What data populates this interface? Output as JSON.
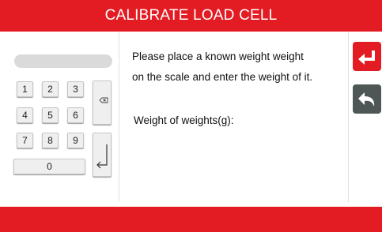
{
  "header": {
    "title": "CALIBRATE LOAD CELL"
  },
  "keypad": {
    "display_value": "",
    "keys": [
      "1",
      "2",
      "3",
      "4",
      "5",
      "6",
      "7",
      "8",
      "9",
      "0"
    ],
    "backspace_icon": "backspace-icon",
    "enter_icon": "enter-arrow-icon"
  },
  "instructions": {
    "line1": "Please place a known weight weight",
    "line2": "on the scale and enter the weight of it.",
    "weight_label": "Weight of weights(g):"
  },
  "side_buttons": {
    "confirm_icon": "return-arrow-icon",
    "back_icon": "back-arrow-icon"
  },
  "colors": {
    "accent": "#e31b23",
    "back_button": "#4e5656",
    "key_bg": "#efefef"
  }
}
